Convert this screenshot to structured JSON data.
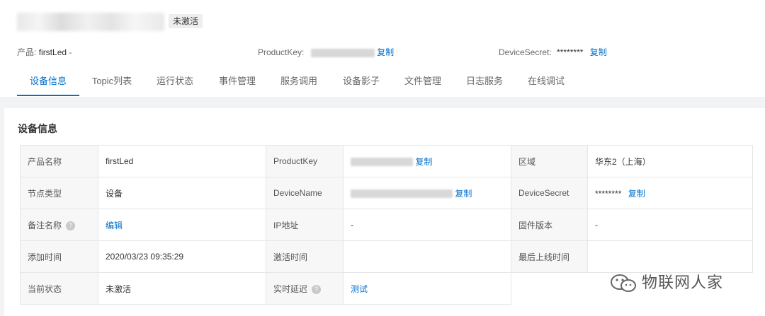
{
  "header": {
    "status_badge": "未激活",
    "product_label": "产品:",
    "product_value": "firstLed",
    "product_suffix": "-",
    "productkey_label": "ProductKey:",
    "productkey_copy": "复制",
    "devicesecret_label": "DeviceSecret:",
    "devicesecret_value": "********",
    "devicesecret_copy": "复制"
  },
  "tabs": [
    {
      "label": "设备信息"
    },
    {
      "label": "Topic列表"
    },
    {
      "label": "运行状态"
    },
    {
      "label": "事件管理"
    },
    {
      "label": "服务调用"
    },
    {
      "label": "设备影子"
    },
    {
      "label": "文件管理"
    },
    {
      "label": "日志服务"
    },
    {
      "label": "在线调试"
    }
  ],
  "section": {
    "title": "设备信息"
  },
  "info": {
    "r1": {
      "l1": "产品名称",
      "v1": "firstLed",
      "l2": "ProductKey",
      "v2_copy": "复制",
      "l3": "区域",
      "v3": "华东2（上海）"
    },
    "r2": {
      "l1": "节点类型",
      "v1": "设备",
      "l2": "DeviceName",
      "v2_copy": "复制",
      "l3": "DeviceSecret",
      "v3": "********",
      "v3_copy": "复制"
    },
    "r3": {
      "l1": "备注名称",
      "v1": "编辑",
      "l2": "IP地址",
      "v2": "-",
      "l3": "固件版本",
      "v3": "-"
    },
    "r4": {
      "l1": "添加时间",
      "v1": "2020/03/23 09:35:29",
      "l2": "激活时间",
      "v2": "",
      "l3": "最后上线时间",
      "v3": ""
    },
    "r5": {
      "l1": "当前状态",
      "v1": "未激活",
      "l2": "实时延迟",
      "v2": "测试"
    }
  },
  "watermark": {
    "text": "物联网人家",
    "icon": "wechat-icon"
  },
  "colors": {
    "link": "#0070cc",
    "label_bg": "#f7f7f7",
    "page_bg": "#f2f3f5"
  }
}
